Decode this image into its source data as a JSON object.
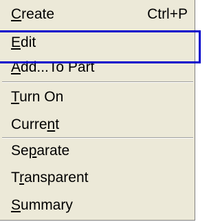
{
  "menu": {
    "items": [
      {
        "pre": "",
        "key": "C",
        "post": "reate",
        "shortcut": "Ctrl+P"
      },
      {
        "pre": "",
        "key": "E",
        "post": "dit",
        "shortcut": ""
      },
      {
        "pre": "",
        "key": "A",
        "post": "dd...To Part",
        "shortcut": ""
      },
      {
        "pre": "",
        "key": "T",
        "post": "urn On",
        "shortcut": ""
      },
      {
        "pre": "Curre",
        "key": "n",
        "post": "t",
        "shortcut": ""
      },
      {
        "pre": "Se",
        "key": "p",
        "post": "arate",
        "shortcut": ""
      },
      {
        "pre": "T",
        "key": "r",
        "post": "ansparent",
        "shortcut": ""
      },
      {
        "pre": "",
        "key": "S",
        "post": "ummary",
        "shortcut": ""
      }
    ]
  },
  "colors": {
    "menu_background": "#ece9d8",
    "highlight_outline": "#0000cc"
  }
}
